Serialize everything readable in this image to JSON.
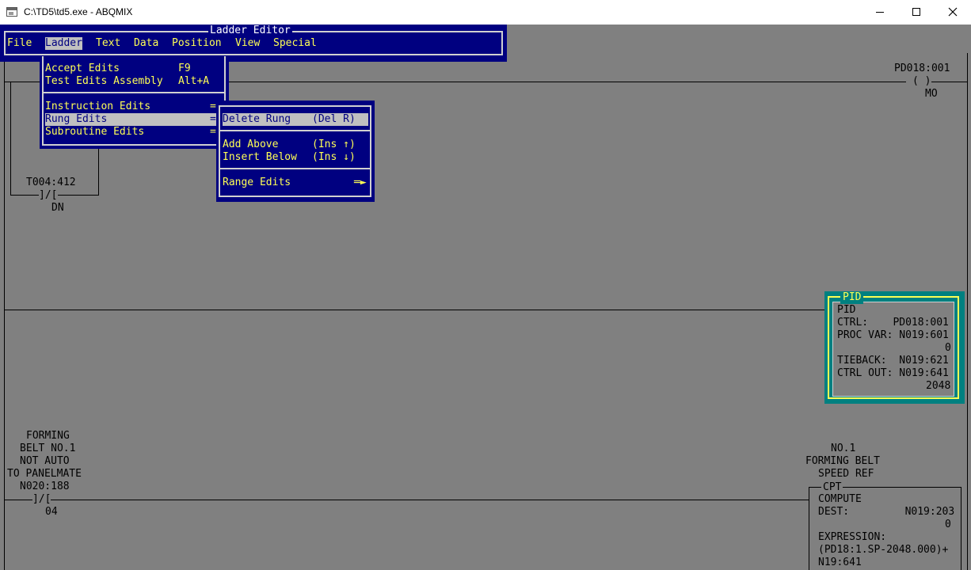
{
  "window": {
    "title": "C:\\TD5\\td5.exe - ABQMIX"
  },
  "editor": {
    "title": "Ladder Editor",
    "menu": [
      "File",
      "Ladder",
      "Text",
      "Data",
      "Position",
      "View",
      "Special"
    ],
    "active_menu": "Ladder"
  },
  "ladder_menu": {
    "items": [
      {
        "label": "Accept Edits",
        "shortcut": "F9"
      },
      {
        "label": "Test Edits Assembly",
        "shortcut": "Alt+A"
      },
      {
        "label": "Instruction Edits",
        "arrow": "="
      },
      {
        "label": "Rung Edits",
        "arrow": "="
      },
      {
        "label": "Subroutine Edits",
        "arrow": "="
      }
    ],
    "selected": "Rung Edits"
  },
  "rung_menu": {
    "items": [
      {
        "label": "Delete Rung",
        "shortcut": "(Del R)"
      },
      {
        "label": "Add Above",
        "shortcut": "(Ins ↑)"
      },
      {
        "label": "Insert Below",
        "shortcut": "(Ins ↓)"
      },
      {
        "label": "Range Edits",
        "shortcut": "═►"
      }
    ],
    "selected": "Delete Rung"
  },
  "ladder": {
    "rung1": {
      "contact_addr": "T004:412",
      "contact_symbol": "]/[",
      "contact_bit": "DN",
      "coil_addr": "PD018:001",
      "coil_symbol": "( )",
      "coil_bit": "MO"
    },
    "pid": {
      "title": "PID",
      "lines": [
        "PID",
        "CTRL:    PD018:001",
        "PROC VAR: N019:601",
        "0",
        "TIEBACK:  N019:621",
        "CTRL OUT: N019:641",
        "2048"
      ]
    },
    "rung3": {
      "contact_desc": [
        "FORMING",
        "BELT NO.1",
        "NOT AUTO",
        "TO PANELMATE"
      ],
      "contact_addr": "N020:188",
      "contact_symbol": "]/[",
      "contact_bit": "04",
      "output_desc": [
        "NO.1",
        "FORMING BELT",
        "SPEED REF"
      ],
      "cpt": {
        "title": "CPT",
        "lines": [
          "COMPUTE",
          "DEST:         N019:203",
          "0",
          "EXPRESSION:",
          "(PD18:1.SP-2048.000)+",
          "N19:641"
        ]
      }
    }
  }
}
